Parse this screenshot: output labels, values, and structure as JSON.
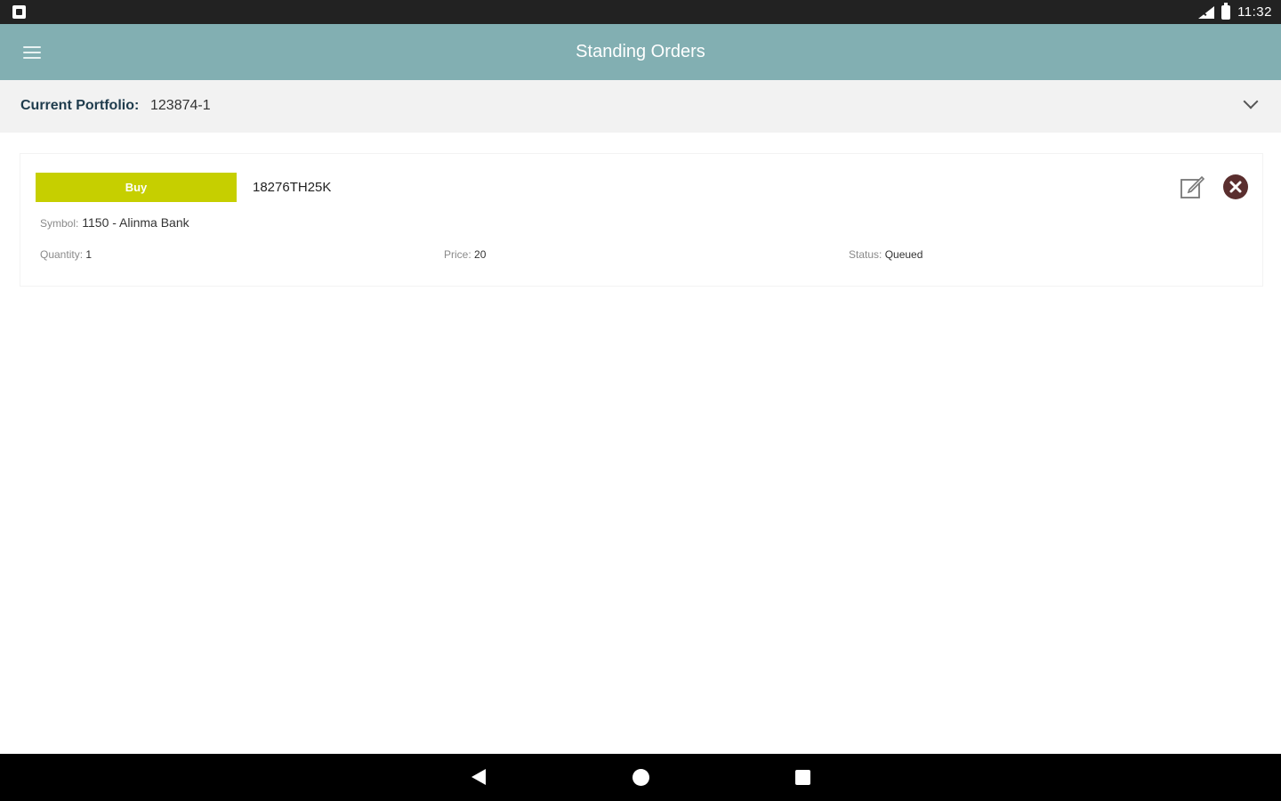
{
  "status_bar": {
    "time": "11:32",
    "icons": [
      "app-notification-icon",
      "signal-icon",
      "battery-icon"
    ]
  },
  "app_bar": {
    "title": "Standing Orders",
    "menu_icon": "menu-icon"
  },
  "portfolio": {
    "label": "Current Portfolio:",
    "value": "123874-1"
  },
  "orders": [
    {
      "type": "Buy",
      "order_id": "18276TH25K",
      "symbol_label": "Symbol:",
      "symbol_value": "1150 - Alinma Bank",
      "quantity_label": "Quantity:",
      "quantity_value": "1",
      "price_label": "Price:",
      "price_value": "20",
      "status_label": "Status:",
      "status_value": "Queued"
    }
  ],
  "colors": {
    "app_bar": "#82afb2",
    "buy_badge": "#c6cf00",
    "cancel_icon": "#5a2e2e"
  }
}
